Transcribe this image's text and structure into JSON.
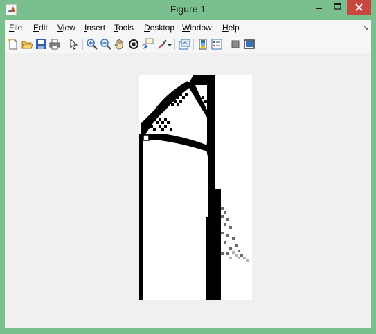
{
  "window": {
    "title": "Figure 1",
    "accent": "#7ac08e",
    "close_color": "#c7463d"
  },
  "menubar": {
    "items": [
      {
        "label": "File",
        "accel": "F",
        "rest": "ile"
      },
      {
        "label": "Edit",
        "accel": "E",
        "rest": "dit"
      },
      {
        "label": "View",
        "accel": "V",
        "rest": "iew"
      },
      {
        "label": "Insert",
        "accel": "I",
        "rest": "nsert"
      },
      {
        "label": "Tools",
        "accel": "T",
        "rest": "ools"
      },
      {
        "label": "Desktop",
        "accel": "D",
        "rest": "esktop"
      },
      {
        "label": "Window",
        "accel": "W",
        "rest": "indow"
      },
      {
        "label": "Help",
        "accel": "H",
        "rest": "elp"
      }
    ]
  },
  "toolbar": {
    "buttons": [
      "new-figure-icon",
      "open-file-icon",
      "save-icon",
      "print-icon",
      "edit-plot-arrow-icon",
      "zoom-in-icon",
      "zoom-out-icon",
      "pan-hand-icon",
      "rotate-3d-icon",
      "data-cursor-icon",
      "brush-icon",
      "brush-dropdown-icon",
      "link-plot-icon",
      "insert-colorbar-icon",
      "insert-legend-icon",
      "hide-plot-tools-icon",
      "show-plot-tools-icon"
    ]
  },
  "figure": {
    "content": "topology optimization black-white density image"
  }
}
